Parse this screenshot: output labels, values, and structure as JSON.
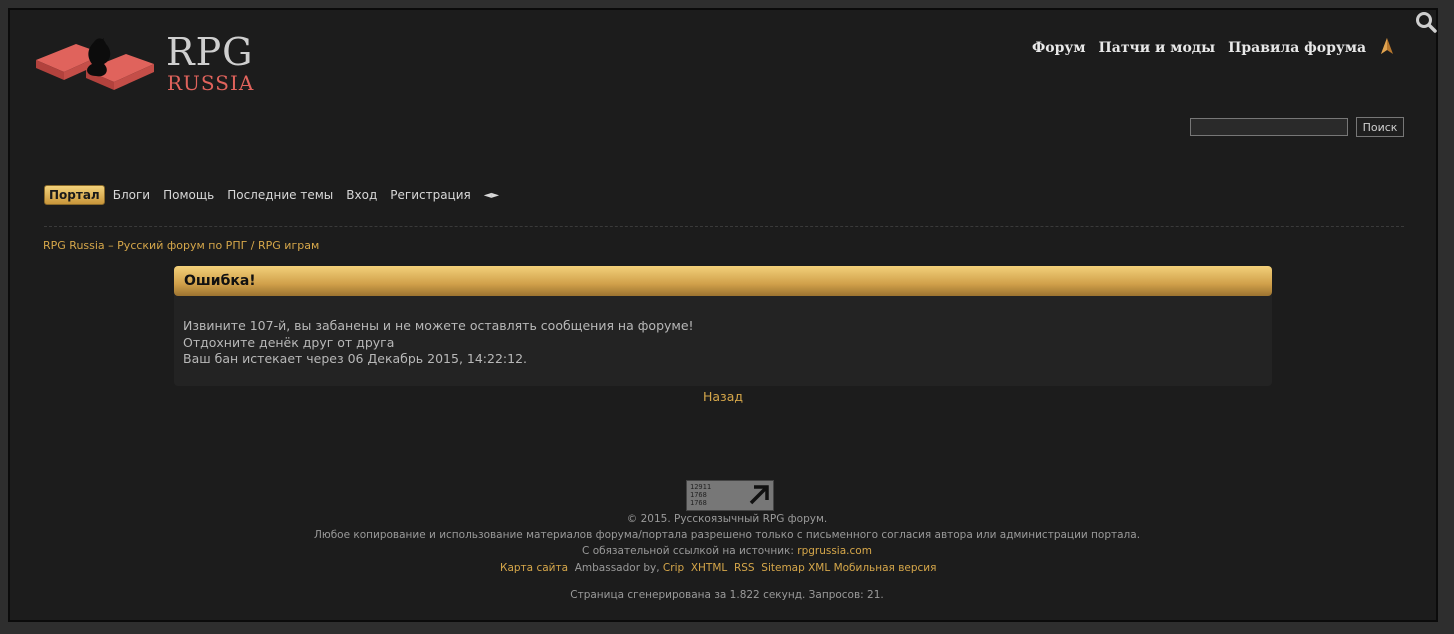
{
  "logo": {
    "title_top": "RPG",
    "title_bottom": "RUSSIA"
  },
  "topnav": [
    "Форум",
    "Патчи и моды",
    "Правила форума"
  ],
  "search": {
    "button_label": "Поиск",
    "value": ""
  },
  "menu": {
    "items": [
      {
        "label": "Портал",
        "active": true
      },
      {
        "label": "Блоги"
      },
      {
        "label": "Помощь"
      },
      {
        "label": "Последние темы"
      },
      {
        "label": "Вход"
      },
      {
        "label": "Регистрация"
      }
    ],
    "arrows": "◄►"
  },
  "breadcrumb": "RPG Russia – Русский форум по РПГ / RPG играм",
  "error": {
    "title": "Ошибка!",
    "line1": "Извините 107-й, вы забанены и не можете оставлять сообщения на форуме!",
    "line2": "Отдохните денёк друг от друга",
    "line3": "Ваш бан истекает через 06 Декабрь 2015, 14:22:12."
  },
  "back_label": "Назад",
  "counter": {
    "lines": "12911\n1768\n1768"
  },
  "footer": {
    "copyright": "© 2015. Русскоязычный RPG форум.",
    "notice": "Любое копирование и использование материалов форума/портала разрешено только с письменного согласия автора или администрации портала.",
    "source_prefix": "С обязательной ссылкой на источник:",
    "source_link": "rpgrussia.com",
    "sitemap": "Карта сайта",
    "ambassador": "Ambassador by,",
    "crip": "Crip",
    "xhtml": "XHTML",
    "rss": "RSS",
    "sitemap_xml": "Sitemap XML",
    "mobile": "Мобильная версия",
    "generated": "Страница сгенерирована за 1.822 секунд. Запросов: 21."
  },
  "colors": {
    "accent": "#d6a74a",
    "logo_red": "#e0635c",
    "background": "#1c1c1c"
  }
}
